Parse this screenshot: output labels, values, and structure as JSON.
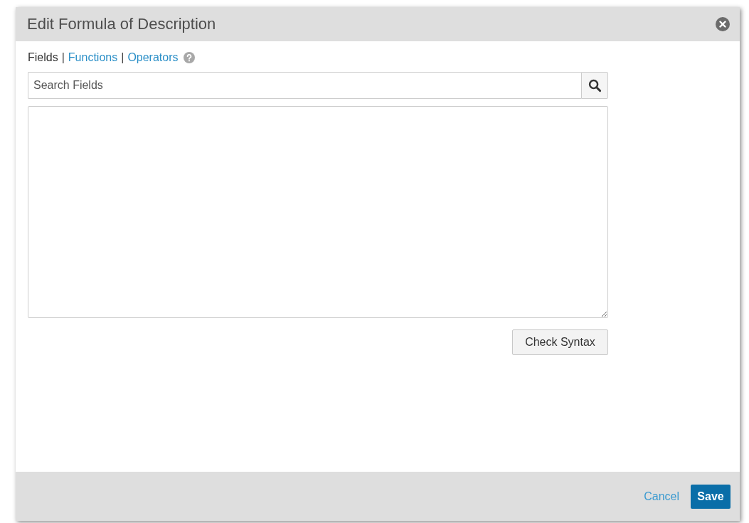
{
  "dialog": {
    "title": "Edit Formula of Description"
  },
  "tabs": [
    {
      "label": "Fields",
      "selected": true
    },
    {
      "label": "Functions",
      "selected": false
    },
    {
      "label": "Operators",
      "selected": false
    }
  ],
  "separator": "|",
  "search": {
    "placeholder": "Search Fields"
  },
  "check_button": "Check Syntax",
  "footer": {
    "cancel": "Cancel",
    "save": "Save"
  }
}
